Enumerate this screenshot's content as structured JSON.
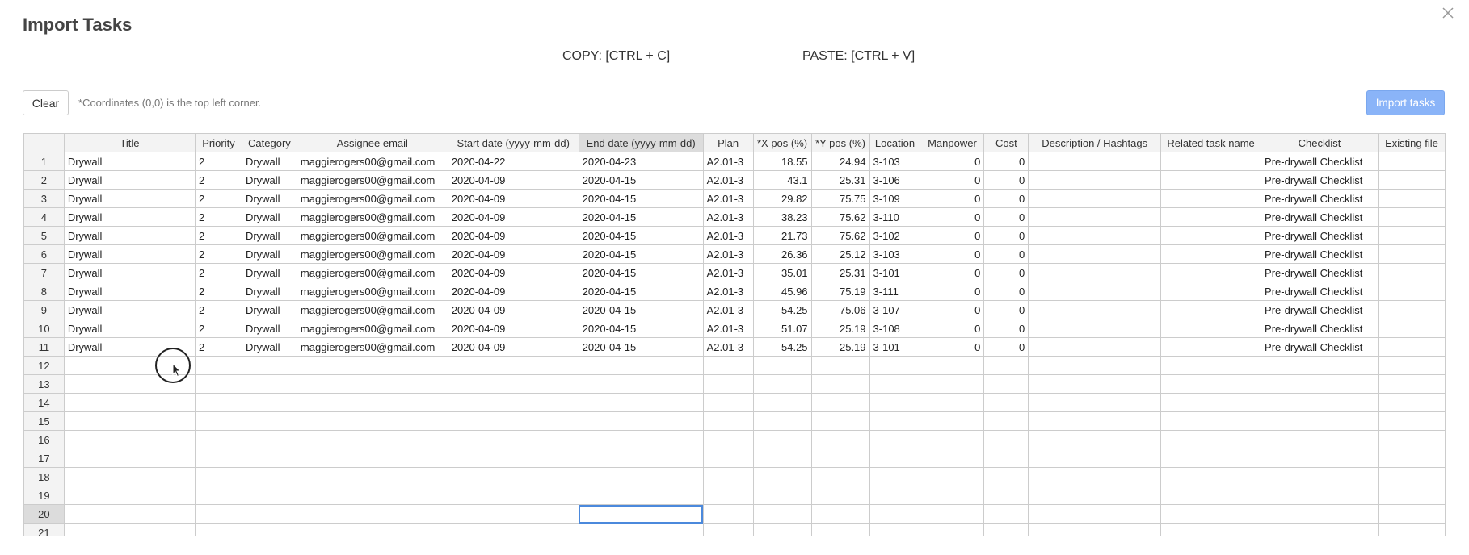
{
  "modal": {
    "title": "Import Tasks",
    "close_icon": "close-icon"
  },
  "shortcuts": {
    "copy": "COPY: [CTRL + C]",
    "paste": "PASTE: [CTRL + V]"
  },
  "toolbar": {
    "clear_label": "Clear",
    "hint": "*Coordinates (0,0) is the top left corner.",
    "import_label": "Import tasks"
  },
  "grid": {
    "columns": [
      "",
      "Title",
      "Priority",
      "Category",
      "Assignee email",
      "Start date (yyyy-mm-dd)",
      "End date (yyyy-mm-dd)",
      "Plan",
      "*X pos (%)",
      "*Y pos (%)",
      "Location",
      "Manpower",
      "Cost",
      "Description / Hashtags",
      "Related task name",
      "Checklist",
      "Existing file"
    ],
    "active_column": 6,
    "active_row": 20,
    "rows": [
      [
        "1",
        "Drywall",
        "2",
        "Drywall",
        "maggierogers00@gmail.com",
        "2020-04-22",
        "2020-04-23",
        "A2.01-3",
        "18.55",
        "24.94",
        "3-103",
        "0",
        "0",
        "",
        "",
        "Pre-drywall Checklist",
        ""
      ],
      [
        "2",
        "Drywall",
        "2",
        "Drywall",
        "maggierogers00@gmail.com",
        "2020-04-09",
        "2020-04-15",
        "A2.01-3",
        "43.1",
        "25.31",
        "3-106",
        "0",
        "0",
        "",
        "",
        "Pre-drywall Checklist",
        ""
      ],
      [
        "3",
        "Drywall",
        "2",
        "Drywall",
        "maggierogers00@gmail.com",
        "2020-04-09",
        "2020-04-15",
        "A2.01-3",
        "29.82",
        "75.75",
        "3-109",
        "0",
        "0",
        "",
        "",
        "Pre-drywall Checklist",
        ""
      ],
      [
        "4",
        "Drywall",
        "2",
        "Drywall",
        "maggierogers00@gmail.com",
        "2020-04-09",
        "2020-04-15",
        "A2.01-3",
        "38.23",
        "75.62",
        "3-110",
        "0",
        "0",
        "",
        "",
        "Pre-drywall Checklist",
        ""
      ],
      [
        "5",
        "Drywall",
        "2",
        "Drywall",
        "maggierogers00@gmail.com",
        "2020-04-09",
        "2020-04-15",
        "A2.01-3",
        "21.73",
        "75.62",
        "3-102",
        "0",
        "0",
        "",
        "",
        "Pre-drywall Checklist",
        ""
      ],
      [
        "6",
        "Drywall",
        "2",
        "Drywall",
        "maggierogers00@gmail.com",
        "2020-04-09",
        "2020-04-15",
        "A2.01-3",
        "26.36",
        "25.12",
        "3-103",
        "0",
        "0",
        "",
        "",
        "Pre-drywall Checklist",
        ""
      ],
      [
        "7",
        "Drywall",
        "2",
        "Drywall",
        "maggierogers00@gmail.com",
        "2020-04-09",
        "2020-04-15",
        "A2.01-3",
        "35.01",
        "25.31",
        "3-101",
        "0",
        "0",
        "",
        "",
        "Pre-drywall Checklist",
        ""
      ],
      [
        "8",
        "Drywall",
        "2",
        "Drywall",
        "maggierogers00@gmail.com",
        "2020-04-09",
        "2020-04-15",
        "A2.01-3",
        "45.96",
        "75.19",
        "3-111",
        "0",
        "0",
        "",
        "",
        "Pre-drywall Checklist",
        ""
      ],
      [
        "9",
        "Drywall",
        "2",
        "Drywall",
        "maggierogers00@gmail.com",
        "2020-04-09",
        "2020-04-15",
        "A2.01-3",
        "54.25",
        "75.06",
        "3-107",
        "0",
        "0",
        "",
        "",
        "Pre-drywall Checklist",
        ""
      ],
      [
        "10",
        "Drywall",
        "2",
        "Drywall",
        "maggierogers00@gmail.com",
        "2020-04-09",
        "2020-04-15",
        "A2.01-3",
        "51.07",
        "25.19",
        "3-108",
        "0",
        "0",
        "",
        "",
        "Pre-drywall Checklist",
        ""
      ],
      [
        "11",
        "Drywall",
        "2",
        "Drywall",
        "maggierogers00@gmail.com",
        "2020-04-09",
        "2020-04-15",
        "A2.01-3",
        "54.25",
        "25.19",
        "3-101",
        "0",
        "0",
        "",
        "",
        "Pre-drywall Checklist",
        ""
      ],
      [
        "12",
        "",
        "",
        "",
        "",
        "",
        "",
        "",
        "",
        "",
        "",
        "",
        "",
        "",
        "",
        "",
        ""
      ],
      [
        "13",
        "",
        "",
        "",
        "",
        "",
        "",
        "",
        "",
        "",
        "",
        "",
        "",
        "",
        "",
        "",
        ""
      ],
      [
        "14",
        "",
        "",
        "",
        "",
        "",
        "",
        "",
        "",
        "",
        "",
        "",
        "",
        "",
        "",
        "",
        ""
      ],
      [
        "15",
        "",
        "",
        "",
        "",
        "",
        "",
        "",
        "",
        "",
        "",
        "",
        "",
        "",
        "",
        "",
        ""
      ],
      [
        "16",
        "",
        "",
        "",
        "",
        "",
        "",
        "",
        "",
        "",
        "",
        "",
        "",
        "",
        "",
        "",
        ""
      ],
      [
        "17",
        "",
        "",
        "",
        "",
        "",
        "",
        "",
        "",
        "",
        "",
        "",
        "",
        "",
        "",
        "",
        ""
      ],
      [
        "18",
        "",
        "",
        "",
        "",
        "",
        "",
        "",
        "",
        "",
        "",
        "",
        "",
        "",
        "",
        "",
        ""
      ],
      [
        "19",
        "",
        "",
        "",
        "",
        "",
        "",
        "",
        "",
        "",
        "",
        "",
        "",
        "",
        "",
        "",
        ""
      ],
      [
        "20",
        "",
        "",
        "",
        "",
        "",
        "",
        "",
        "",
        "",
        "",
        "",
        "",
        "",
        "",
        "",
        ""
      ],
      [
        "21",
        "",
        "",
        "",
        "",
        "",
        "",
        "",
        "",
        "",
        "",
        "",
        "",
        "",
        "",
        "",
        ""
      ]
    ]
  },
  "pointer_icon": "mouse-cursor-icon"
}
